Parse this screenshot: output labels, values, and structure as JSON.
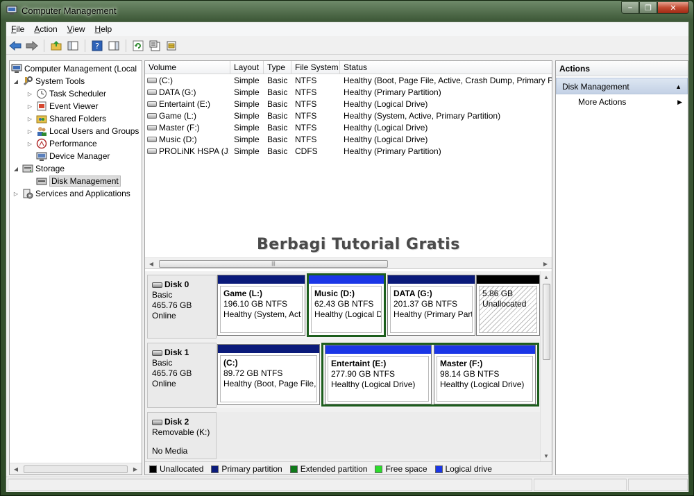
{
  "window": {
    "title": "Computer Management"
  },
  "menubar": {
    "items": [
      {
        "label": "File",
        "key": "F",
        "rest": "ile"
      },
      {
        "label": "Action",
        "key": "A",
        "rest": "ction"
      },
      {
        "label": "View",
        "key": "V",
        "rest": "iew"
      },
      {
        "label": "Help",
        "key": "H",
        "rest": "elp"
      }
    ]
  },
  "tree": {
    "root": "Computer Management (Local",
    "system_tools": "System Tools",
    "task_scheduler": "Task Scheduler",
    "event_viewer": "Event Viewer",
    "shared_folders": "Shared Folders",
    "local_users": "Local Users and Groups",
    "performance": "Performance",
    "device_manager": "Device Manager",
    "storage": "Storage",
    "disk_management": "Disk Management",
    "services": "Services and Applications"
  },
  "volumes": {
    "headers": [
      "Volume",
      "Layout",
      "Type",
      "File System",
      "Status"
    ],
    "rows": [
      {
        "volume": "(C:)",
        "layout": "Simple",
        "type": "Basic",
        "fs": "NTFS",
        "status": "Healthy (Boot, Page File, Active, Crash Dump, Primary Pa"
      },
      {
        "volume": "DATA (G:)",
        "layout": "Simple",
        "type": "Basic",
        "fs": "NTFS",
        "status": "Healthy (Primary Partition)"
      },
      {
        "volume": "Entertaint (E:)",
        "layout": "Simple",
        "type": "Basic",
        "fs": "NTFS",
        "status": "Healthy (Logical Drive)"
      },
      {
        "volume": "Game (L:)",
        "layout": "Simple",
        "type": "Basic",
        "fs": "NTFS",
        "status": "Healthy (System, Active, Primary Partition)"
      },
      {
        "volume": "Master (F:)",
        "layout": "Simple",
        "type": "Basic",
        "fs": "NTFS",
        "status": "Healthy (Logical Drive)"
      },
      {
        "volume": "Music (D:)",
        "layout": "Simple",
        "type": "Basic",
        "fs": "NTFS",
        "status": "Healthy (Logical Drive)"
      },
      {
        "volume": "PROLiNK HSPA (J:)",
        "layout": "Simple",
        "type": "Basic",
        "fs": "CDFS",
        "status": "Healthy (Primary Partition)"
      }
    ]
  },
  "watermark": "Berbagi Tutorial Gratis",
  "disks": {
    "disk0": {
      "name": "Disk 0",
      "type": "Basic",
      "size": "465.76 GB",
      "state": "Online",
      "parts": [
        {
          "name": "Game  (L:)",
          "size": "196.10 GB NTFS",
          "status": "Healthy (System, Act"
        },
        {
          "name": "Music  (D:)",
          "size": "62.43 GB NTFS",
          "status": "Healthy (Logical D"
        },
        {
          "name": "DATA  (G:)",
          "size": "201.37 GB NTFS",
          "status": "Healthy (Primary Part"
        },
        {
          "name": "",
          "size": "5.86 GB",
          "status": "Unallocated"
        }
      ]
    },
    "disk1": {
      "name": "Disk 1",
      "type": "Basic",
      "size": "465.76 GB",
      "state": "Online",
      "parts": [
        {
          "name": "(C:)",
          "size": "89.72 GB NTFS",
          "status": "Healthy (Boot, Page File, ."
        },
        {
          "name": "Entertaint  (E:)",
          "size": "277.90 GB NTFS",
          "status": "Healthy (Logical Drive)"
        },
        {
          "name": "Master  (F:)",
          "size": "98.14 GB NTFS",
          "status": "Healthy (Logical Drive)"
        }
      ]
    },
    "disk2": {
      "name": "Disk 2",
      "type": "Removable (K:)",
      "state": "No Media"
    }
  },
  "legend": [
    {
      "label": "Unallocated",
      "color": "#000000"
    },
    {
      "label": "Primary partition",
      "color": "#0a1a7a"
    },
    {
      "label": "Extended partition",
      "color": "#0f7a1a"
    },
    {
      "label": "Free space",
      "color": "#2bdc2b"
    },
    {
      "label": "Logical drive",
      "color": "#1a36e6"
    }
  ],
  "actions": {
    "header": "Actions",
    "section": "Disk Management",
    "more": "More Actions"
  },
  "colors": {
    "primary_bar": "#0a1a7a",
    "logical_bar": "#1a36e6",
    "unalloc_bar": "#000000",
    "selected_border": "#1d5e1d"
  }
}
